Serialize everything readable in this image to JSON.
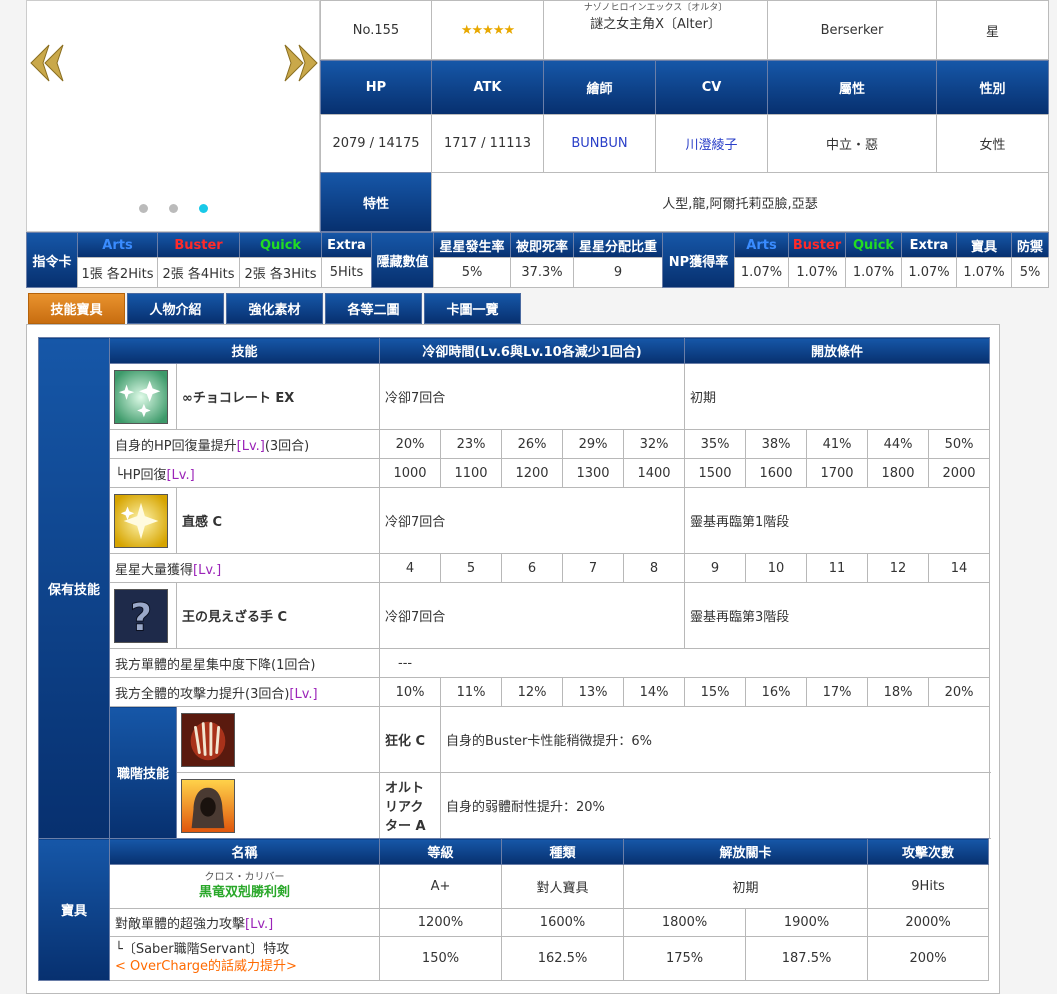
{
  "top": {
    "no": "No.155",
    "stars": "★★★★★",
    "name_ruby": "ナゾノヒロインエックス〔オルタ〕",
    "name": "謎之女主角X〔Alter〕",
    "class": "Berserker",
    "star_col": "星",
    "headers": [
      "HP",
      "ATK",
      "繪師",
      "CV",
      "屬性",
      "性別"
    ],
    "values": [
      "2079 / 14175",
      "1717 / 11113",
      "BUNBUN",
      "川澄綾子",
      "中立・惡",
      "女性"
    ],
    "trait_label": "特性",
    "traits": "人型,龍,阿爾托莉亞臉,亞瑟"
  },
  "cards": {
    "label": "指令卡",
    "arts": "Arts",
    "buster": "Buster",
    "quick": "Quick",
    "extra": "Extra",
    "arts_v": "1張 各2Hits",
    "buster_v": "2張 各4Hits",
    "quick_v": "2張 各3Hits",
    "extra_v": "5Hits",
    "hidden": "隱藏數值",
    "h1": "星星發生率",
    "h2": "被即死率",
    "h3": "星星分配比重",
    "v1": "5%",
    "v2": "37.3%",
    "v3": "9",
    "np": "NP獲得率",
    "n1": "Arts",
    "n2": "Buster",
    "n3": "Quick",
    "n4": "Extra",
    "n5": "寶具",
    "n6": "防禦",
    "nv1": "1.07%",
    "nv2": "1.07%",
    "nv3": "1.07%",
    "nv4": "1.07%",
    "nv5": "1.07%",
    "nv6": "5%"
  },
  "tabs": [
    "技能寶具",
    "人物介紹",
    "強化素材",
    "各等二圖",
    "卡圖一覽"
  ],
  "skills": {
    "section": "保有技能",
    "h_skill": "技能",
    "h_cd": "冷卻時間(Lv.6與Lv.10各減少1回合)",
    "h_cond": "開放條件",
    "lv": "[Lv.]",
    "s1": {
      "name": "∞チョコレート EX",
      "cd": "冷卻7回合",
      "cond": "初期",
      "e1": "自身的HP回復量提升",
      "e1s": "(3回合)",
      "e1v": [
        "20%",
        "23%",
        "26%",
        "29%",
        "32%",
        "35%",
        "38%",
        "41%",
        "44%",
        "50%"
      ],
      "e2": "└HP回復",
      "e2v": [
        "1000",
        "1100",
        "1200",
        "1300",
        "1400",
        "1500",
        "1600",
        "1700",
        "1800",
        "2000"
      ]
    },
    "s2": {
      "name": "直感 C",
      "cd": "冷卻7回合",
      "cond": "靈基再臨第1階段",
      "e1": "星星大量獲得",
      "e1v": [
        "4",
        "5",
        "6",
        "7",
        "8",
        "9",
        "10",
        "11",
        "12",
        "14"
      ]
    },
    "s3": {
      "name": "王の見えざる手 C",
      "cd": "冷卻7回合",
      "cond": "靈基再臨第3階段",
      "e1": "我方單體的星星集中度下降(1回合)",
      "e1v": "---",
      "e2": "我方全體的攻擊力提升(3回合)",
      "e2v": [
        "10%",
        "11%",
        "12%",
        "13%",
        "14%",
        "15%",
        "16%",
        "17%",
        "18%",
        "20%"
      ]
    }
  },
  "class_skills": {
    "section": "職階技能",
    "c1": {
      "name": "狂化 C",
      "desc": "自身的Buster卡性能稍微提升：6%"
    },
    "c2": {
      "name": "オルトリアクター A",
      "desc": "自身的弱體耐性提升：20%"
    }
  },
  "np": {
    "section": "寶具",
    "h_name": "名稱",
    "h_rank": "等級",
    "h_type": "種類",
    "h_unlock": "解放關卡",
    "h_hits": "攻擊次數",
    "ruby": "クロス・カリバー",
    "name": "黒竜双剋勝利剣",
    "rank": "A+",
    "type": "對人寶具",
    "unlock": "初期",
    "hits": "9Hits",
    "e1": "對敵單體的超強力攻擊",
    "e1v": [
      "1200%",
      "1600%",
      "1800%",
      "1900%",
      "2000%"
    ],
    "e2": "└〔Saber職階Servant〕特攻",
    "e2b": "< OverCharge的話威力提升>",
    "e2v": [
      "150%",
      "162.5%",
      "175%",
      "187.5%",
      "200%"
    ]
  },
  "colors": {
    "arts": "#3a8cff",
    "buster": "#ff2222",
    "quick": "#22cc22",
    "lv": "#9b24b8",
    "np_name": "#2aa82a",
    "overcharge": "#ff6a00"
  }
}
